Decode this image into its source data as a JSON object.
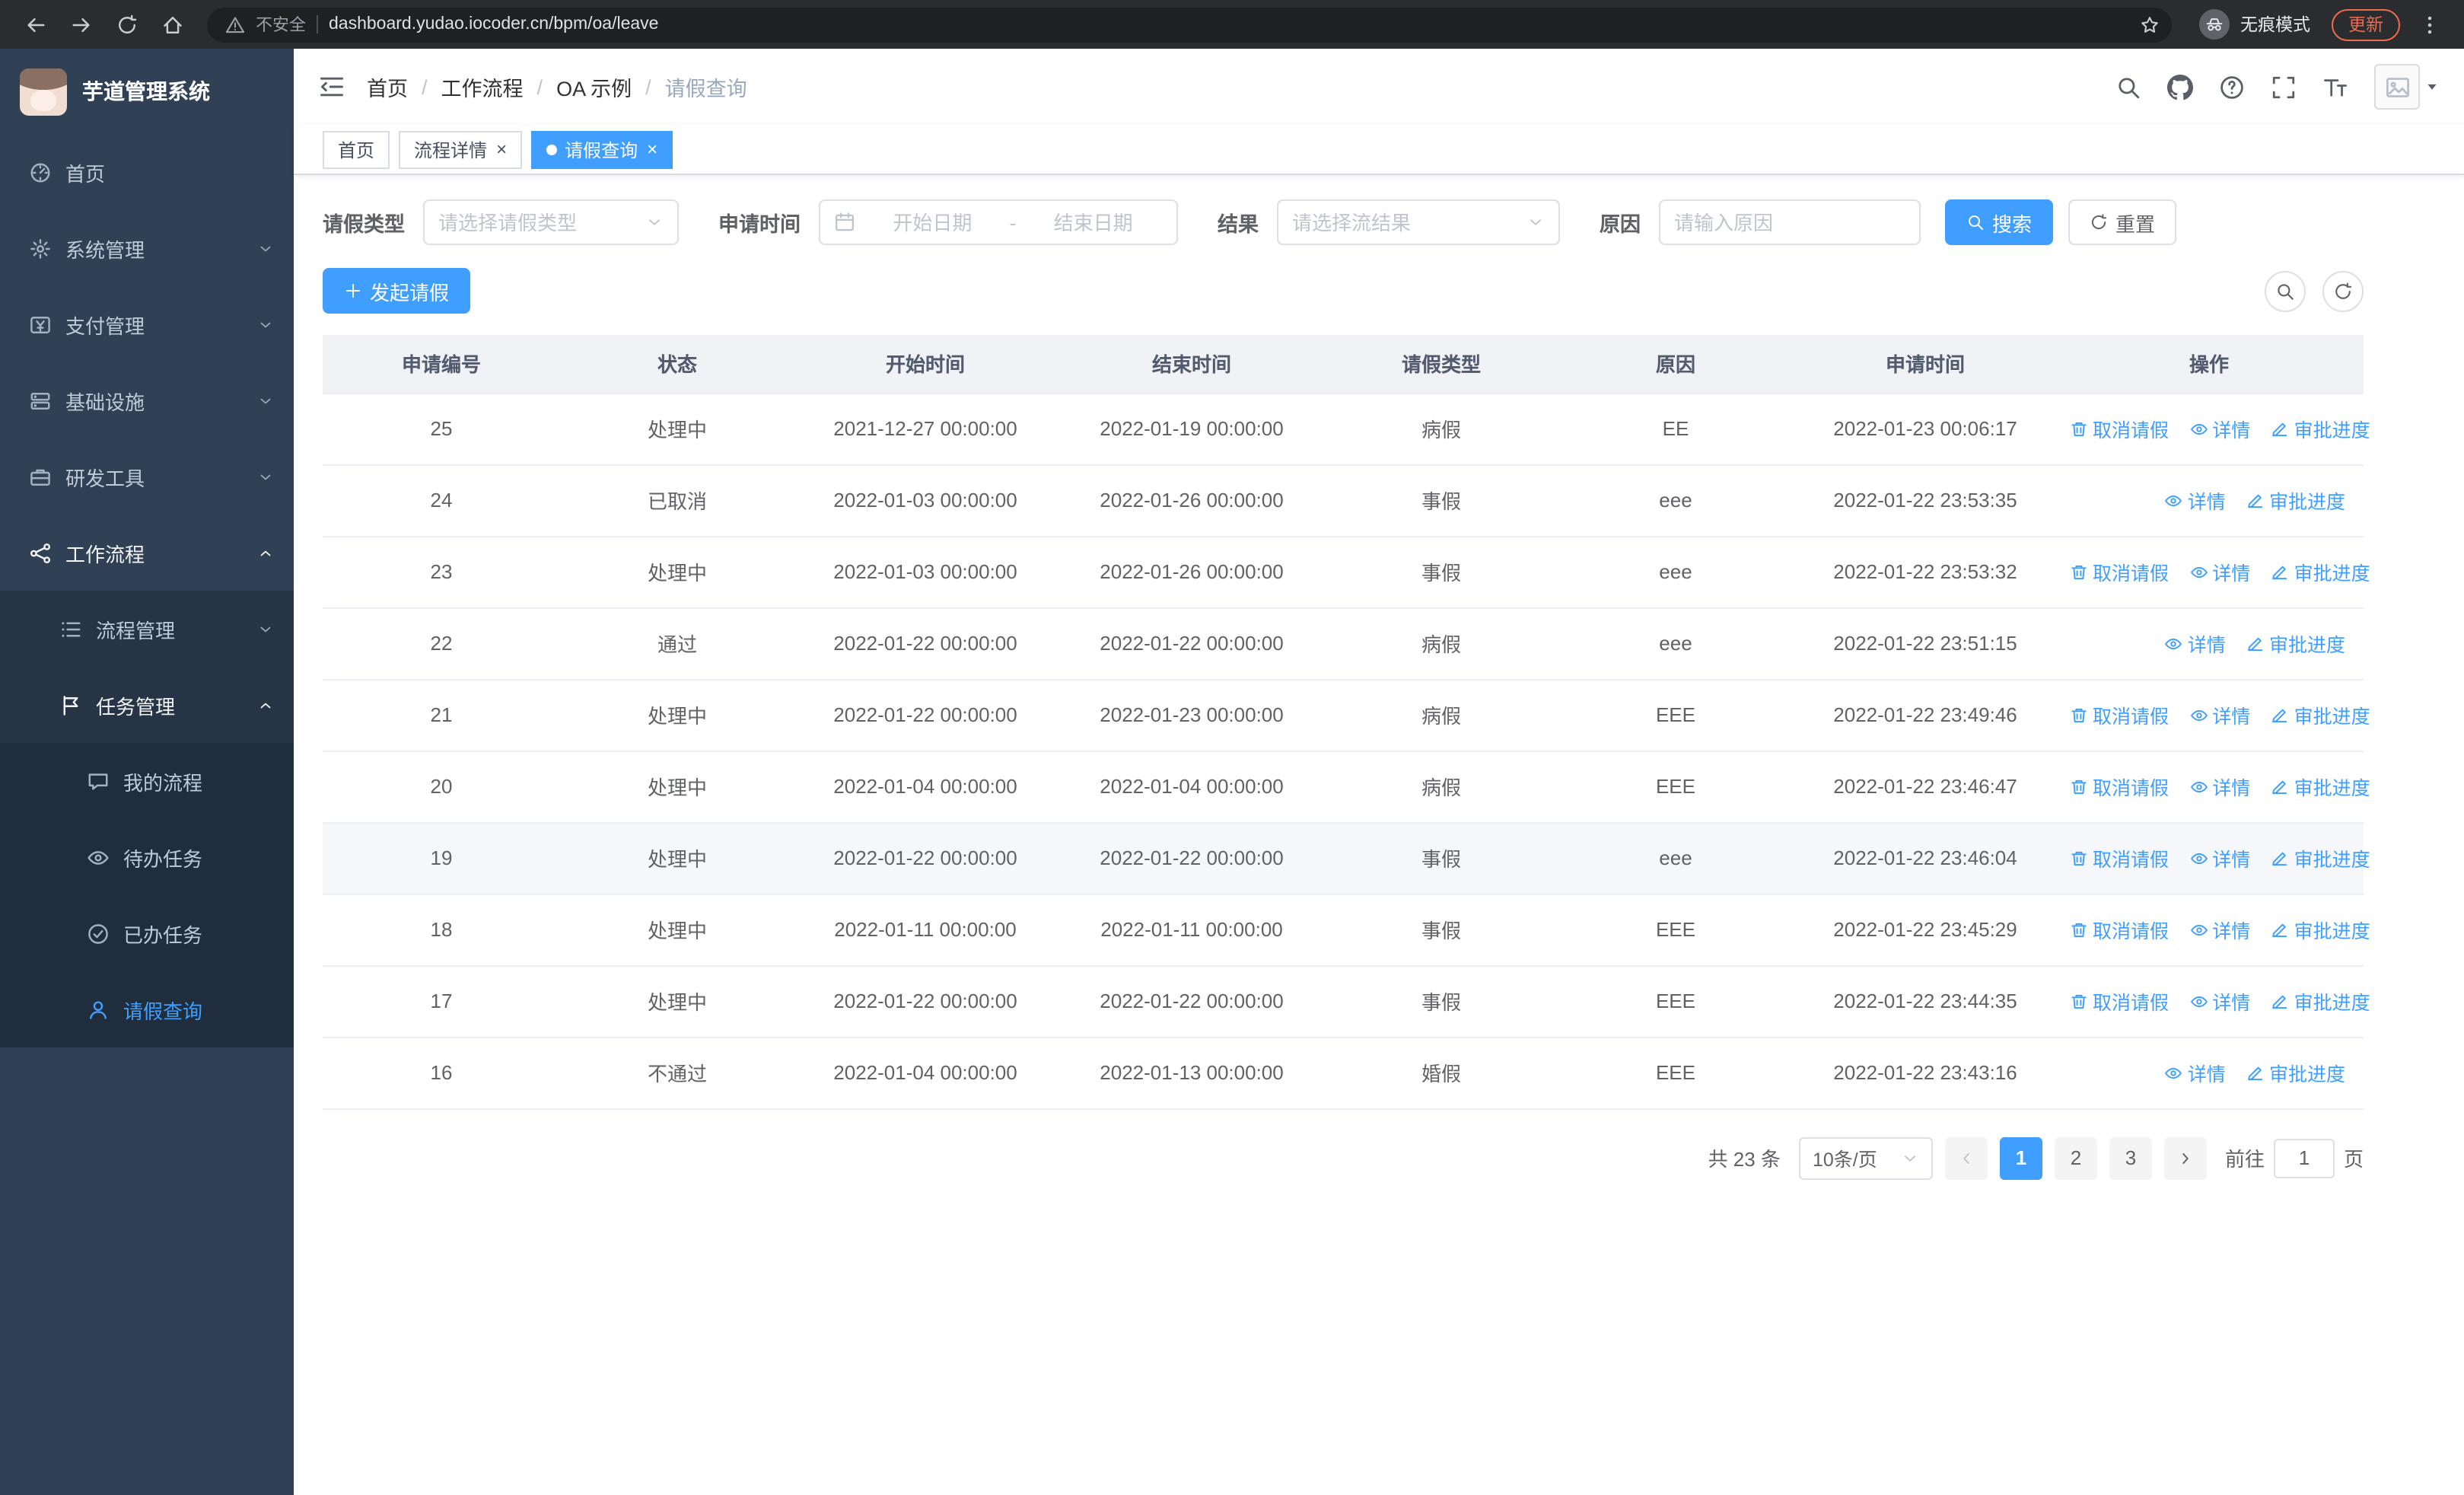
{
  "browser": {
    "nav_icons": [
      "back-icon",
      "forward-icon",
      "reload-icon",
      "home-icon"
    ],
    "warning_icon": "warning-icon",
    "security_warning": "不安全",
    "url": "dashboard.yudao.iocoder.cn/bpm/oa/leave",
    "star_icon": "star-icon",
    "incognito_icon": "incognito-icon",
    "incognito_label": "无痕模式",
    "update_button": "更新",
    "menu_icon": "kebab-icon"
  },
  "sidebar": {
    "logo_title": "芋道管理系统",
    "menu": [
      {
        "id": "sidebar-item-home",
        "label": "首页",
        "icon": "dashboard-icon",
        "level": 1
      },
      {
        "id": "sidebar-item-system-mgmt",
        "label": "系统管理",
        "icon": "gear-icon",
        "level": 1,
        "chevron": "chevron-down-icon"
      },
      {
        "id": "sidebar-item-payment-mgmt",
        "label": "支付管理",
        "icon": "payment-icon",
        "level": 1,
        "chevron": "chevron-down-icon"
      },
      {
        "id": "sidebar-item-infrastructure",
        "label": "基础设施",
        "icon": "infrastructure-icon",
        "level": 1,
        "chevron": "chevron-down-icon"
      },
      {
        "id": "sidebar-item-dev-tools",
        "label": "研发工具",
        "icon": "devtools-icon",
        "level": 1,
        "chevron": "chevron-down-icon"
      },
      {
        "id": "sidebar-item-workflow",
        "label": "工作流程",
        "icon": "workflow-icon",
        "level": 1,
        "chevron": "chevron-up-icon",
        "expanded": true
      },
      {
        "id": "sidebar-item-process-mgmt",
        "label": "流程管理",
        "icon": "process-icon",
        "level": 2,
        "chevron": "chevron-down-icon"
      },
      {
        "id": "sidebar-item-task-mgmt",
        "label": "任务管理",
        "icon": "task-icon",
        "level": 2,
        "chevron": "chevron-up-icon",
        "expanded": true
      },
      {
        "id": "sidebar-item-my-process",
        "label": "我的流程",
        "icon": "my-process-icon",
        "level": 3
      },
      {
        "id": "sidebar-item-todo-tasks",
        "label": "待办任务",
        "icon": "todo-icon",
        "level": 3
      },
      {
        "id": "sidebar-item-done-tasks",
        "label": "已办任务",
        "icon": "done-icon",
        "level": 3
      },
      {
        "id": "sidebar-item-leave-query",
        "label": "请假查询",
        "icon": "leave-query-icon",
        "level": 3,
        "active": true
      }
    ]
  },
  "navbar": {
    "collapse_icon": "collapse-icon",
    "breadcrumb": {
      "separator": "/",
      "items": [
        {
          "label": "首页",
          "has_sep": true
        },
        {
          "label": "工作流程",
          "has_sep": true
        },
        {
          "label": "OA 示例",
          "has_sep": true
        },
        {
          "label": "请假查询",
          "last": true
        }
      ]
    },
    "right_icons": [
      {
        "name": "search-icon"
      },
      {
        "name": "github-icon"
      },
      {
        "name": "question-icon"
      },
      {
        "name": "fullscreen-icon"
      },
      {
        "name": "fontsize-icon"
      }
    ],
    "avatar_icon": "image-icon",
    "avatar_caret_icon": "caret-down-icon"
  },
  "tabs": {
    "close_glyph": "×",
    "items": [
      {
        "id": "tab-home",
        "label": "首页"
      },
      {
        "id": "tab-process-detail",
        "label": "流程详情",
        "closable": true
      },
      {
        "id": "tab-leave-query",
        "label": "请假查询",
        "closable": true,
        "active": true
      }
    ]
  },
  "filter": {
    "leave_type_label": "请假类型",
    "leave_type_placeholder": "请选择请假类型",
    "select_caret_icon": "chevron-down-icon",
    "apply_time_label": "申请时间",
    "date_icon": "calendar-icon",
    "start_placeholder": "开始日期",
    "range_separator": "-",
    "end_placeholder": "结束日期",
    "result_label": "结果",
    "result_placeholder": "请选择流结果",
    "reason_label": "原因",
    "reason_placeholder": "请输入原因",
    "search_icon": "search-icon",
    "search_button": "搜索",
    "reset_icon": "refresh-icon",
    "reset_button": "重置"
  },
  "toolbar": {
    "create_icon": "plus-icon",
    "create_button": "发起请假",
    "right_icons": [
      {
        "name": "search-icon"
      },
      {
        "name": "refresh-icon"
      }
    ]
  },
  "table": {
    "headers": [
      "申请编号",
      "状态",
      "开始时间",
      "结束时间",
      "请假类型",
      "原因",
      "申请时间",
      "操作"
    ],
    "actions": {
      "cancel": {
        "label": "取消请假",
        "icon": "delete-icon"
      },
      "detail": {
        "label": "详情",
        "icon": "eye-icon"
      },
      "progress": {
        "label": "审批进度",
        "icon": "edit-icon"
      }
    },
    "rows": [
      {
        "no": "25",
        "status": "处理中",
        "start_time": "2021-12-27 00:00:00",
        "end_time": "2022-01-19 00:00:00",
        "leave_type": "病假",
        "reason": "EE",
        "apply_time": "2022-01-23 00:06:17",
        "can_cancel": true
      },
      {
        "no": "24",
        "status": "已取消",
        "start_time": "2022-01-03 00:00:00",
        "end_time": "2022-01-26 00:00:00",
        "leave_type": "事假",
        "reason": "eee",
        "apply_time": "2022-01-22 23:53:35",
        "can_cancel": false
      },
      {
        "no": "23",
        "status": "处理中",
        "start_time": "2022-01-03 00:00:00",
        "end_time": "2022-01-26 00:00:00",
        "leave_type": "事假",
        "reason": "eee",
        "apply_time": "2022-01-22 23:53:32",
        "can_cancel": true
      },
      {
        "no": "22",
        "status": "通过",
        "start_time": "2022-01-22 00:00:00",
        "end_time": "2022-01-22 00:00:00",
        "leave_type": "病假",
        "reason": "eee",
        "apply_time": "2022-01-22 23:51:15",
        "can_cancel": false
      },
      {
        "no": "21",
        "status": "处理中",
        "start_time": "2022-01-22 00:00:00",
        "end_time": "2022-01-23 00:00:00",
        "leave_type": "病假",
        "reason": "EEE",
        "apply_time": "2022-01-22 23:49:46",
        "can_cancel": true
      },
      {
        "no": "20",
        "status": "处理中",
        "start_time": "2022-01-04 00:00:00",
        "end_time": "2022-01-04 00:00:00",
        "leave_type": "病假",
        "reason": "EEE",
        "apply_time": "2022-01-22 23:46:47",
        "can_cancel": true
      },
      {
        "no": "19",
        "status": "处理中",
        "start_time": "2022-01-22 00:00:00",
        "end_time": "2022-01-22 00:00:00",
        "leave_type": "事假",
        "reason": "eee",
        "apply_time": "2022-01-22 23:46:04",
        "can_cancel": true,
        "highlighted": true
      },
      {
        "no": "18",
        "status": "处理中",
        "start_time": "2022-01-11 00:00:00",
        "end_time": "2022-01-11 00:00:00",
        "leave_type": "事假",
        "reason": "EEE",
        "apply_time": "2022-01-22 23:45:29",
        "can_cancel": true
      },
      {
        "no": "17",
        "status": "处理中",
        "start_time": "2022-01-22 00:00:00",
        "end_time": "2022-01-22 00:00:00",
        "leave_type": "事假",
        "reason": "EEE",
        "apply_time": "2022-01-22 23:44:35",
        "can_cancel": true
      },
      {
        "no": "16",
        "status": "不通过",
        "start_time": "2022-01-04 00:00:00",
        "end_time": "2022-01-13 00:00:00",
        "leave_type": "婚假",
        "reason": "EEE",
        "apply_time": "2022-01-22 23:43:16",
        "can_cancel": false
      }
    ]
  },
  "pagination": {
    "total_label": "共 23 条",
    "page_size": "10条/页",
    "size_caret_icon": "chevron-down-icon",
    "prev_icon": "chevron-left-icon",
    "prev_disabled": true,
    "pages": [
      {
        "label": "1",
        "active": true
      },
      {
        "label": "2"
      },
      {
        "label": "3"
      }
    ],
    "next_icon": "chevron-right-icon",
    "goto_label": "前往",
    "goto_value": "1",
    "goto_unit": "页"
  },
  "colors": {
    "accent": "#409eff",
    "sidebar_bg": "#304156",
    "sidebar_submenu_bg": "#263445",
    "sidebar_deep_bg": "#1f2d3d",
    "sidebar_text": "#bfcbd9",
    "table_header_bg": "#f0f2f5",
    "row_border": "#ebeef5",
    "chrome_bg": "#2b2c2f",
    "omnibox_bg": "#1f2021",
    "update_button": "#ee6c4d"
  }
}
